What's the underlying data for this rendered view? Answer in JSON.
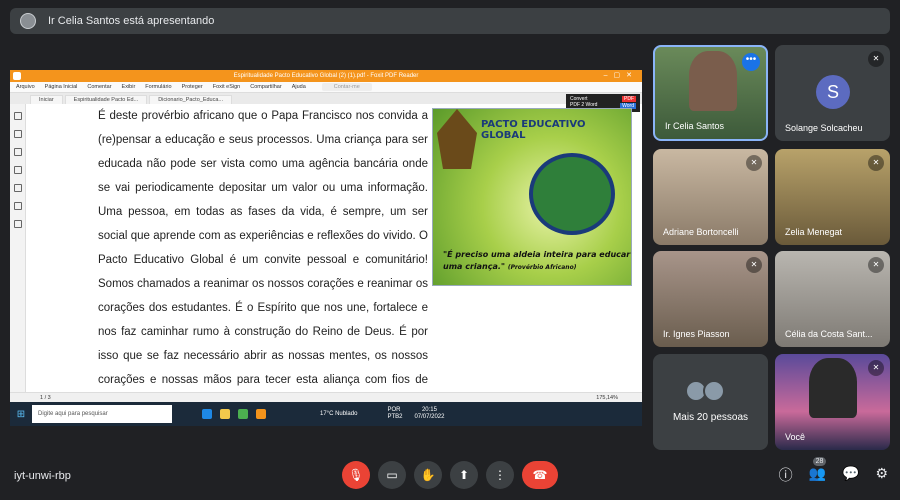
{
  "banner": {
    "text": "Ir Celia Santos está apresentando"
  },
  "screen": {
    "app_title": "Espiritualidade Pacto Educativo Global (2) (1).pdf - Foxit PDF Reader",
    "menu": [
      "Arquivo",
      "Página Inicial",
      "Comentar",
      "Exibir",
      "Formulário",
      "Proteger",
      "Foxit eSign",
      "Compartilhar",
      "Ajuda"
    ],
    "search_placeholder": "Contar-me",
    "tabs": [
      "Iniciar",
      "Espiritualidade Pacto Ed...",
      "Dicionario_Pacto_Educa..."
    ],
    "convert": {
      "line1": "Convert",
      "line2": "PDF 2 Word",
      "pdf_tag": "PDF",
      "word_tag": "Word"
    },
    "paragraph": "É deste provérbio africano que o Papa Francisco nos convida a (re)pensar a educação e seus processos. Uma criança para ser educada não pode ser vista como uma agência bancária onde se vai periodicamente depositar um valor ou uma informação. Uma pessoa, em todas as fases da vida, é sempre, um ser social que aprende com as experiências e reflexões do vivido. O Pacto Educativo Global é um convite pessoal e comunitário! Somos chamados a reanimar os nossos corações e reanimar os corações dos estudantes. É o Espírito que nos une, fortalece e nos faz caminhar rumo à construção do Reino de Deus. É por isso que se faz necessário abrir as nossas mentes, os nossos corações e nossas mãos para tecer esta aliança com fios de fraternidade e de solidariedade.",
    "poster": {
      "title": "PACTO EDUCATIVO GLOBAL",
      "quote": "\"É preciso uma aldeia inteira para educar uma criança.\"",
      "attribution": "(Provérbio Africano)"
    },
    "page_indicator": "1 / 3",
    "zoom": "175,14%",
    "taskbar": {
      "search_placeholder": "Digite aqui para pesquisar",
      "weather": "17°C  Nublado",
      "lang_line1": "POR",
      "lang_line2": "PTB2",
      "time": "20:15",
      "date": "07/07/2022"
    }
  },
  "participants": [
    {
      "name": "Ir Celia Santos",
      "muted": false,
      "active": true
    },
    {
      "name": "Solange Solcacheu",
      "muted": true,
      "initial": "S"
    },
    {
      "name": "Adriane Bortoncelli",
      "muted": true
    },
    {
      "name": "Zelia Menegat",
      "muted": true
    },
    {
      "name": "Ir. Ignes Piasson",
      "muted": true
    },
    {
      "name": "Célia da Costa Sant...",
      "muted": true
    },
    {
      "name": "Mais 20 pessoas"
    },
    {
      "name": "Você",
      "muted": true
    }
  ],
  "bottom": {
    "meeting_code": "iyt-unwi-rbp",
    "participant_count": "28"
  },
  "colors": {
    "accent": "#8ab4f8",
    "danger": "#ea4335",
    "background": "#202124",
    "tile": "#3c4043"
  }
}
